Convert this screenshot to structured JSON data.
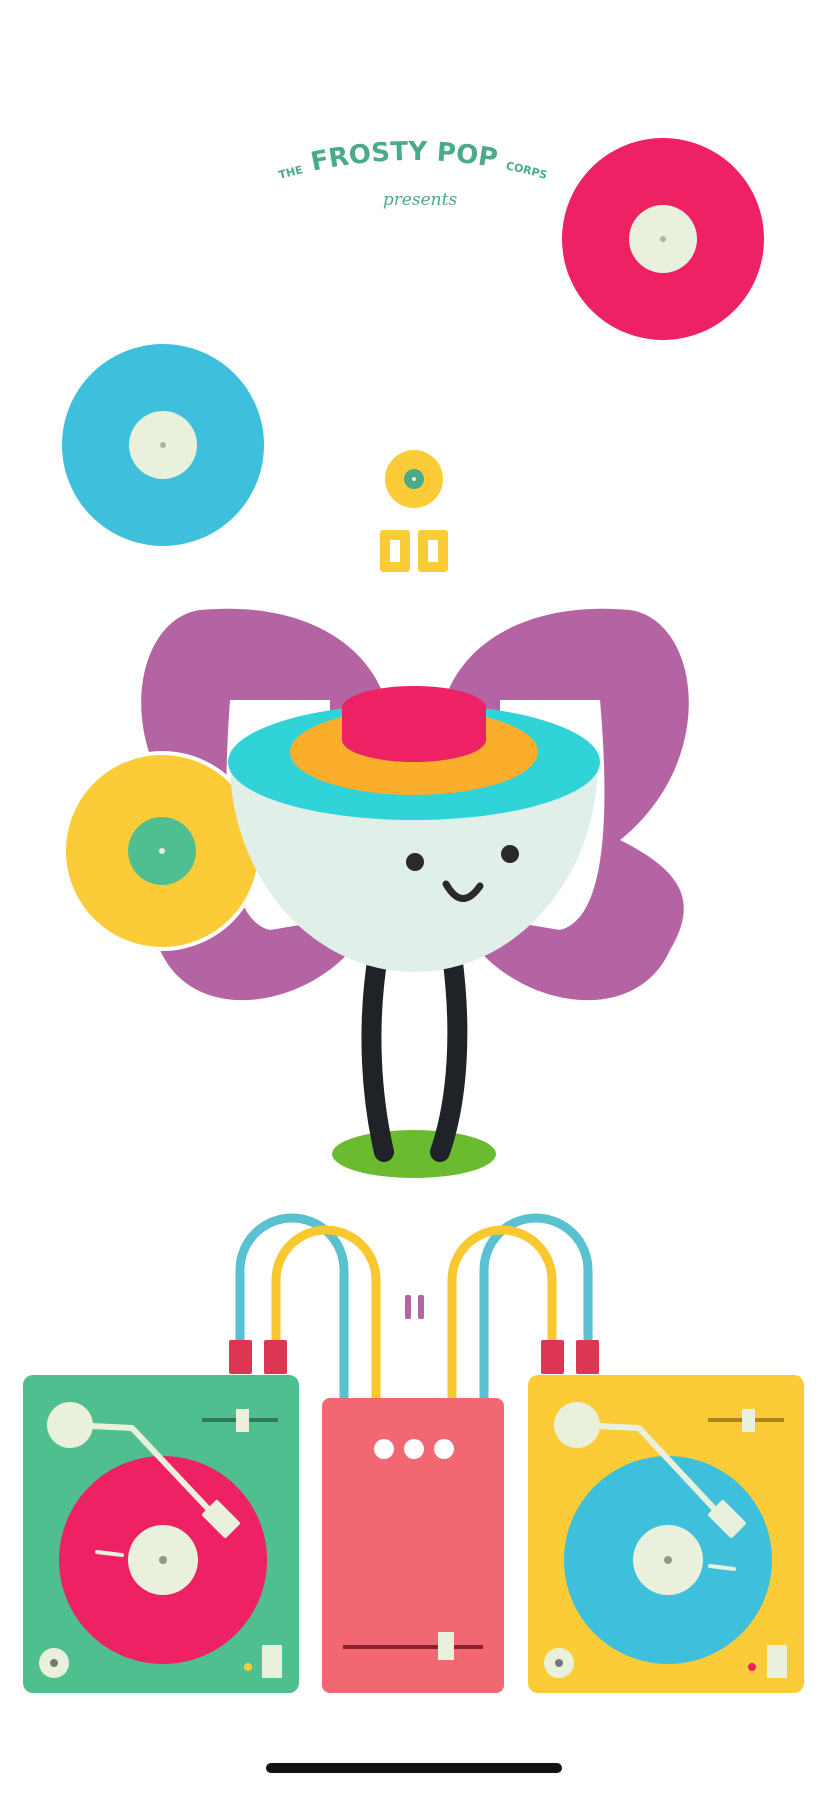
{
  "branding": {
    "the": "THE",
    "name": "FROSTY POP",
    "corps": "CORPS",
    "presents": "presents"
  },
  "title_glyph": "i",
  "pause_glyph": "II",
  "colors": {
    "background": "#ffffff",
    "brand_green": "#4aaa8a",
    "pink": "#ed2164",
    "blue": "#3ec0dc",
    "yellow": "#fbcc37",
    "cream": "#e9f1dd",
    "purple": "#b464a3",
    "teal": "#2fd3d8",
    "orange": "#fbae2b",
    "green_deck": "#4fbf90",
    "mixer": "#f16873",
    "grass": "#6bbb31",
    "plug_red": "#dd3652",
    "cable_blue": "#5ac1d1",
    "cable_yellow": "#f8c82f"
  },
  "icons": {
    "records": [
      "vinyl-record-pink",
      "vinyl-record-blue",
      "vinyl-record-yellow"
    ],
    "character": "bowl-character",
    "left_deck": "turntable-green",
    "right_deck": "turntable-yellow",
    "mixer": "mixer",
    "pause": "pause-icon"
  }
}
